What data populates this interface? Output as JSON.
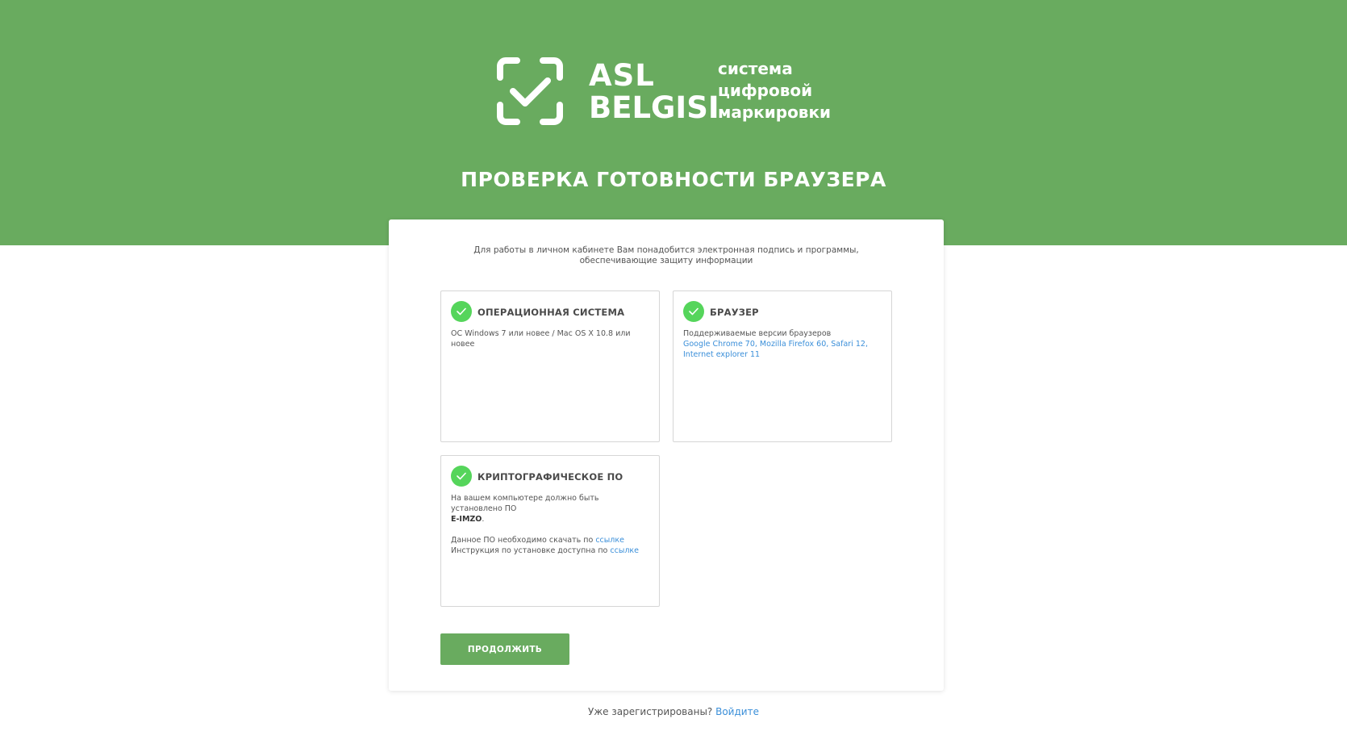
{
  "brand": {
    "line1": "ASL",
    "line2": "BELGISI",
    "tagline": "система\nцифровой\nмаркировки"
  },
  "header": {
    "title": "ПРОВЕРКА ГОТОВНОСТИ БРАУЗЕРА",
    "background_color": "#69ab5f"
  },
  "intro": "Для работы в личном кабинете Вам понадобится электронная подпись и программы,\nобеспечивающие защиту информации",
  "requirements": {
    "os": {
      "title": "ОПЕРАЦИОННАЯ СИСТЕМА",
      "text": "ОС Windows 7 или новее / Mac OS X 10.8 или новее"
    },
    "browser": {
      "title": "БРАУЗЕР",
      "text": "Поддерживаемые версии браузеров",
      "links_line1": "Google Chrome 70, Mozilla Firefox 60, Safari 12,",
      "links_line2": "Internet explorer 11"
    },
    "crypto": {
      "title": "КРИПТОГРАФИЧЕСКОЕ ПО",
      "text1": "На вашем компьютере должно быть установлено ПО",
      "product": "E-IMZO",
      "product_suffix": ".",
      "download_text": "Данное ПО необходимо скачать по ",
      "download_link": "ссылке",
      "instruction_text": "Инструкция по установке доступна по ",
      "instruction_link": "ссылке"
    },
    "status_icon": "check-circle-icon",
    "status_color": "#55d55b"
  },
  "actions": {
    "continue_label": "ПРОДОЛЖИТЬ"
  },
  "footer": {
    "question": "Уже зарегистрированы? ",
    "login_link": "Войдите",
    "link_color": "#3b8fd9"
  }
}
